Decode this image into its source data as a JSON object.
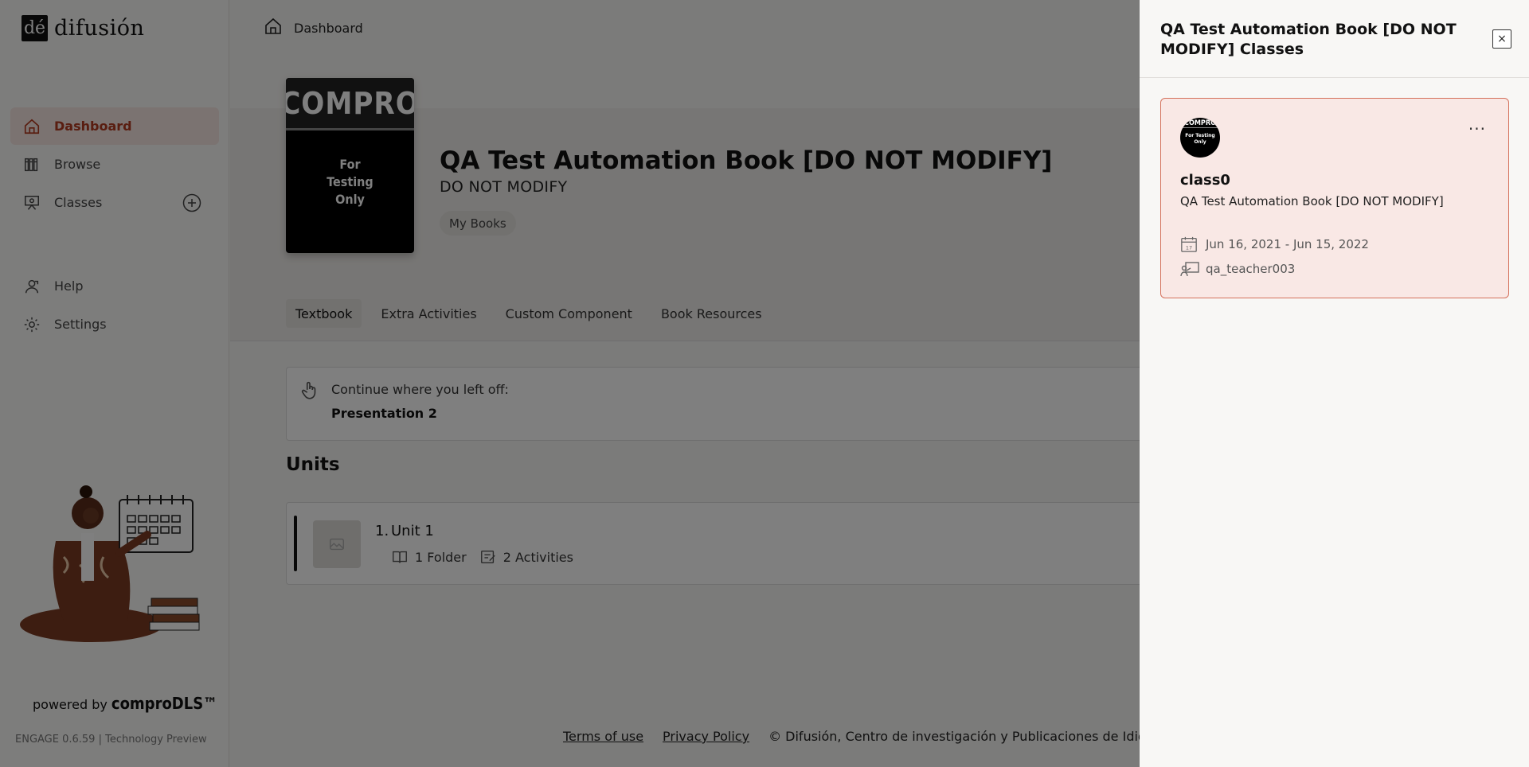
{
  "brand": {
    "logo_mark": "dé",
    "name": "difusión"
  },
  "sidebar": {
    "items": [
      {
        "label": "Dashboard",
        "icon": "home-icon",
        "active": true
      },
      {
        "label": "Browse",
        "icon": "books-icon"
      },
      {
        "label": "Classes",
        "icon": "classroom-icon"
      }
    ],
    "items2": [
      {
        "label": "Help",
        "icon": "help-icon"
      },
      {
        "label": "Settings",
        "icon": "gear-icon"
      }
    ],
    "powered_prefix": "powered by",
    "powered_brand": "comproDLS™",
    "version": "ENGAGE 0.6.59 | Technology Preview"
  },
  "breadcrumb": {
    "label": "Dashboard"
  },
  "book": {
    "cover_top": "COMPRO",
    "cover_bottom_1": "For",
    "cover_bottom_2": "Testing",
    "cover_bottom_3": "Only",
    "title": "QA Test Automation Book [DO NOT MODIFY]",
    "subtitle": "DO NOT MODIFY",
    "tag": "My Books"
  },
  "tabs": [
    "Textbook",
    "Extra Activities",
    "Custom Component",
    "Book Resources"
  ],
  "continue": {
    "label": "Continue where you left off:",
    "value": "Presentation 2"
  },
  "units": {
    "heading": "Units",
    "items": [
      {
        "number": "1.",
        "name": "Unit 1",
        "folders": "1 Folder",
        "activities": "2 Activities"
      }
    ]
  },
  "footer": {
    "terms": "Terms of use",
    "privacy": "Privacy Policy",
    "copyright": "© Difusión, Centro de investigación y Publicaciones de Idiom"
  },
  "drawer": {
    "title": "QA Test Automation Book [DO NOT MODIFY] Classes",
    "close": "×",
    "classes": [
      {
        "name": "class0",
        "book": "QA Test Automation Book [DO NOT MODIFY]",
        "dates": "Jun 16, 2021 - Jun 15, 2022",
        "teacher": "qa_teacher003",
        "more": "···",
        "avatar_top": "COMPRO",
        "avatar_bottom": "For Testing Only"
      }
    ]
  },
  "colors": {
    "accent": "#b33a20",
    "card_border": "#d4705b",
    "card_bg": "#f9e8e5"
  }
}
